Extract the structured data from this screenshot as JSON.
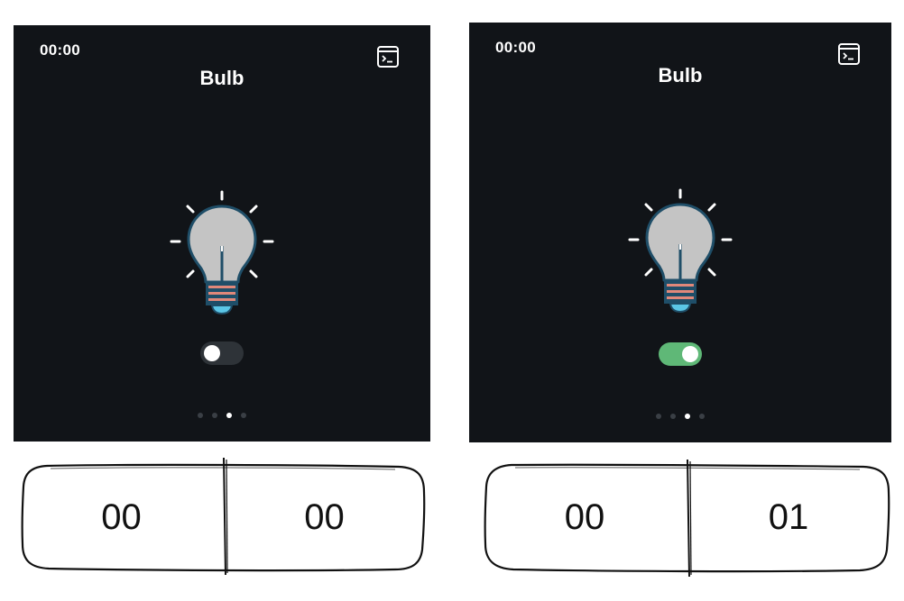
{
  "colors": {
    "screen_bg": "#111418",
    "toggle_on": "#5fb877",
    "toggle_off": "#2e3338",
    "bulb_glass": "#c4c4c4",
    "bulb_outline": "#1f4e68",
    "bulb_bands": "#e0887a",
    "bulb_base": "#5bc6e6"
  },
  "panels": [
    {
      "time": "00:00",
      "title": "Bulb",
      "terminal_icon": "terminal-icon",
      "bulb_icon": "lightbulb-icon",
      "toggle_state": "off",
      "page_count": 4,
      "active_page": 3,
      "counter": {
        "left": "00",
        "right": "00"
      }
    },
    {
      "time": "00:00",
      "title": "Bulb",
      "terminal_icon": "terminal-icon",
      "bulb_icon": "lightbulb-icon",
      "toggle_state": "on",
      "page_count": 4,
      "active_page": 3,
      "counter": {
        "left": "00",
        "right": "01"
      }
    }
  ]
}
